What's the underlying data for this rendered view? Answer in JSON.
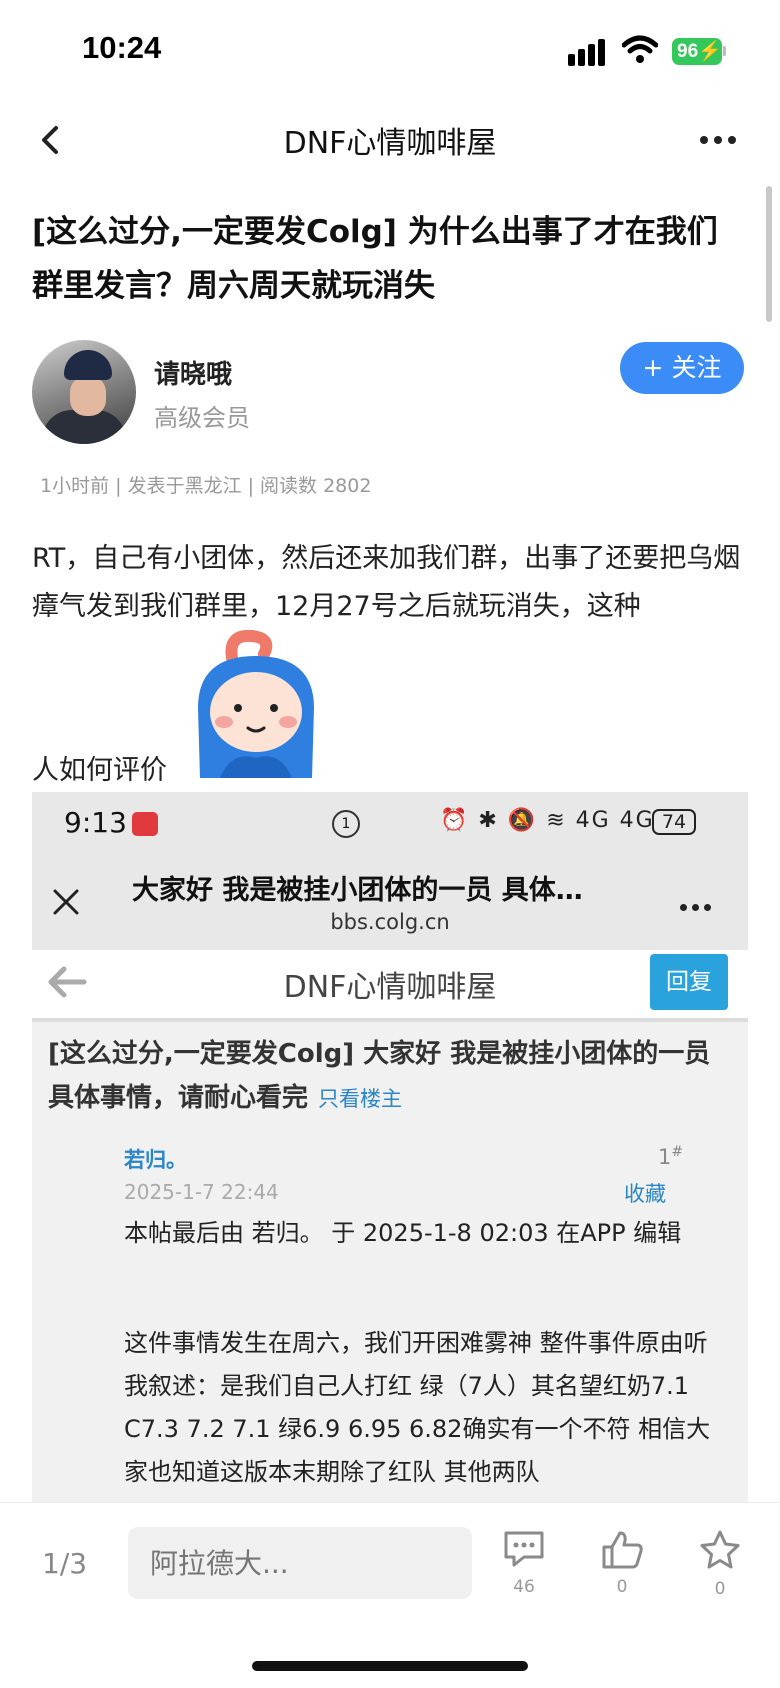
{
  "status": {
    "time": "10:24",
    "battery": "96"
  },
  "nav": {
    "title": "DNF心情咖啡屋"
  },
  "post": {
    "title": "[这么过分,一定要发Colg] 为什么出事了才在我们群里发言？周六周天就玩消失",
    "author_name": "请晓哦",
    "author_level": "高级会员",
    "follow_label": "+ 关注",
    "meta": "1小时前 | 发表于黑龙江 | 阅读数 2802",
    "body_lines": "RT，自己有小团体，然后还来加我们群，出事了还要把乌烟瘴气发到我们群里，12月27号之后就玩消失，这种",
    "body_end": "人如何评价"
  },
  "embedded": {
    "time": "9:13",
    "status_icons": "⏰ ✱ 🔕 ≋ 4G 4G",
    "battery": "74",
    "sync": "1",
    "page_title": "大家好 我是被挂小团体的一员 具体…",
    "url": "bbs.colg.cn",
    "forum_title": "DNF心情咖啡屋",
    "reply_label": "回复",
    "thread_title": "[这么过分,一定要发Colg] 大家好 我是被挂小团体的一员 具体事情，请耐心看完",
    "only_op": "只看楼主",
    "user": "若归。",
    "floor": "1",
    "floor_mark": "#",
    "date": "2025-1-7 22:44",
    "favorite": "收藏",
    "edit_note": "本帖最后由 若归。 于 2025-1-8 02:03 在APP 编辑",
    "content": "这件事情发生在周六，我们开困难雾神 整件事件原由听我叙述：是我们自己人打红 绿（7人）其名望红奶7.1 C7.3 7.2 7.1 绿6.9 6.95 6.82确实有一个不符 相信大家也知道这版本末期除了红队 其他两队"
  },
  "bottom": {
    "page": "1/3",
    "input_placeholder": "阿拉德大...",
    "comments": "46",
    "likes": "0",
    "favorites": "0"
  },
  "colors": {
    "accent": "#3b8cf7",
    "link": "#2a86c8",
    "reply_button": "#2aa2db",
    "battery": "#34c759"
  },
  "icons": [
    "back-icon",
    "more-icon",
    "wifi-icon",
    "signal-icon",
    "close-icon",
    "comment-icon",
    "thumbs-up-icon",
    "star-icon"
  ]
}
